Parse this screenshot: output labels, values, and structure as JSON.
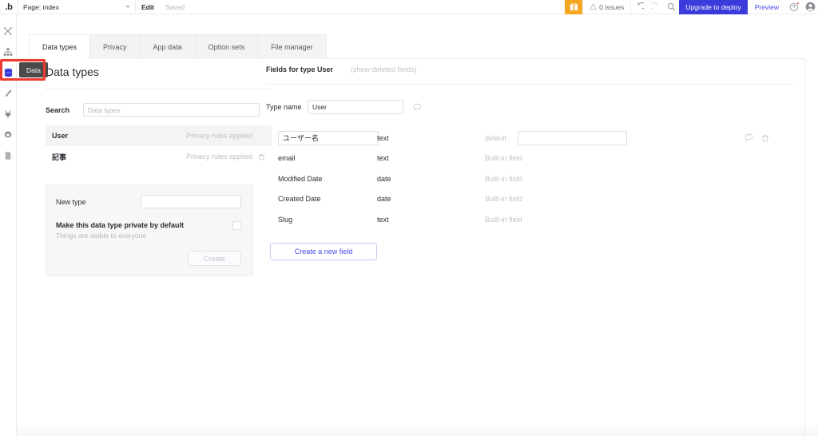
{
  "topbar": {
    "logo": ".b",
    "page_label": "Page: index",
    "edit_label": "Edit",
    "saved_label": "Saved",
    "gift_icon": "gift-icon",
    "issues_label": "0 issues",
    "warning_icon": "warning-triangle-icon",
    "undo_icon": "undo-icon",
    "redo_icon": "redo-icon",
    "search_icon": "search-icon",
    "upgrade_label": "Upgrade to deploy",
    "preview_label": "Preview",
    "help_icon": "help-circle-icon",
    "avatar_icon": "user-avatar-icon",
    "accent_blue": "#3b3bdb",
    "gift_bg": "#f5a623",
    "notification_red": "#e8453c"
  },
  "rail": {
    "items": [
      {
        "icon": "design-tools-icon",
        "active": false
      },
      {
        "icon": "elements-tree-icon",
        "active": false
      },
      {
        "icon": "database-icon",
        "active": true
      },
      {
        "icon": "brush-icon",
        "active": false
      },
      {
        "icon": "plugin-plug-icon",
        "active": false
      },
      {
        "icon": "settings-gear-icon",
        "active": false
      },
      {
        "icon": "logs-file-icon",
        "active": false
      }
    ],
    "tooltip_label": "Data",
    "highlight_color": "#ee3b2f"
  },
  "tabs": [
    {
      "label": "Data types",
      "active": true
    },
    {
      "label": "Privacy",
      "active": false
    },
    {
      "label": "App data",
      "active": false
    },
    {
      "label": "Option sets",
      "active": false
    },
    {
      "label": "File manager",
      "active": false
    }
  ],
  "data_types_panel": {
    "title": "Data types",
    "search_label": "Search",
    "search_placeholder": "Data types",
    "search_value": "",
    "types": [
      {
        "name": "User",
        "meta": "Privacy rules applied",
        "selected": true,
        "deletable": false
      },
      {
        "name": "記事",
        "meta": "Privacy rules applied",
        "selected": false,
        "deletable": true
      }
    ],
    "new_type": {
      "label": "New type",
      "input_value": "",
      "input_placeholder": "",
      "private_label": "Make this data type private by default",
      "private_sub": "Things are visible to everyone",
      "checked": false,
      "create_label": "Create"
    }
  },
  "fields_panel": {
    "title": "Fields for type User",
    "show_deleted_label": "(show deleted fields)",
    "type_name_label": "Type name",
    "type_name_value": "User",
    "comment_icon": "speech-bubble-icon",
    "default_label": "default",
    "builtin_label": "Built-in field",
    "fields": [
      {
        "name": "ユーザー名",
        "type": "text",
        "editable": true,
        "default_value": "",
        "builtin": false
      },
      {
        "name": "email",
        "type": "text",
        "editable": false,
        "default_value": "",
        "builtin": true
      },
      {
        "name": "Modified Date",
        "type": "date",
        "editable": false,
        "default_value": "",
        "builtin": true
      },
      {
        "name": "Created Date",
        "type": "date",
        "editable": false,
        "default_value": "",
        "builtin": true
      },
      {
        "name": "Slug",
        "type": "text",
        "editable": false,
        "default_value": "",
        "builtin": true
      }
    ],
    "create_field_label": "Create a new field",
    "trash_icon": "trash-icon"
  }
}
